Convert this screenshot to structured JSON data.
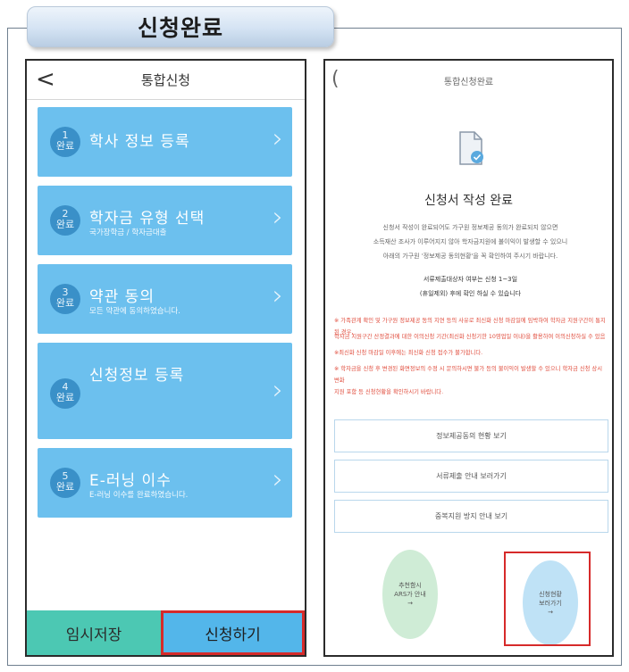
{
  "header_title": "신청완료",
  "left_phone": {
    "title": "통합신청",
    "back_glyph": "<",
    "steps": [
      {
        "num": "1",
        "badge": "완료",
        "title": "학사 정보 등록",
        "sub": ""
      },
      {
        "num": "2",
        "badge": "완료",
        "title": "학자금 유형 선택",
        "sub": "국가장학금 / 학자금대출"
      },
      {
        "num": "3",
        "badge": "완료",
        "title": "약관 동의",
        "sub": "모든 약관에 동의하였습니다."
      },
      {
        "num": "4",
        "badge": "완료",
        "title": "신청정보 등록",
        "sub": ""
      },
      {
        "num": "5",
        "badge": "완료",
        "title": "E-러닝 이수",
        "sub": "E-러닝 이수를 완료하였습니다."
      }
    ],
    "temp_save_label": "임시저장",
    "apply_label": "신청하기"
  },
  "right_phone": {
    "title": "통합신청완료",
    "back_glyph": "(",
    "heading": "신청서 작성 완료",
    "desc_lines": [
      "신청서 작성이 완료되어도 가구원 정보제공 동의가 완료되지 않으면",
      "소득재산 조사가 이루어지지 않아 학자금지원에 불이익이 발생할 수 있으니",
      "아래의 가구원 '정보제공 동의현황'을 꼭 확인하여 주시기 바랍니다."
    ],
    "bold_lines": [
      "서류제출대상자 여부는 신청 1~3일",
      "(휴일제외) 후에 확인 하실 수 있습니다"
    ],
    "warning_lines": [
      "※ 가족관계 확인 및 가구원 정보제공 동의 지연 등의 사유로 최신화 신청 마감일에 임박하여 학자금 지원구간이 통지된 경우,",
      "학자금 지원구간 산정결과에 대한 이의신청 기간(최신화 신청기한 10영업일 이내)을 활용하여 이의신청하실 수 있음",
      "※최신화 신청 마감일 이후에는 최신화 신청 접수가 불가합니다.",
      "※ 학자금을 신청 후 변경된 화면정보의 수정 시 문의하시면 불가 등의 불이익이 발생할 수 있으니 학자금 신청 상시 변화",
      "지원 포함 등 신청현황을 확인하시기 바랍니다."
    ],
    "links": [
      "정보제공동의 현황 보기",
      "서류제출 안내 보러가기",
      "중복지원 방지 안내 보기"
    ],
    "green_circle": [
      "추천함시",
      "ARS가 안내",
      "→"
    ],
    "blue_circle": [
      "신청현황",
      "보러가기",
      "→"
    ]
  }
}
